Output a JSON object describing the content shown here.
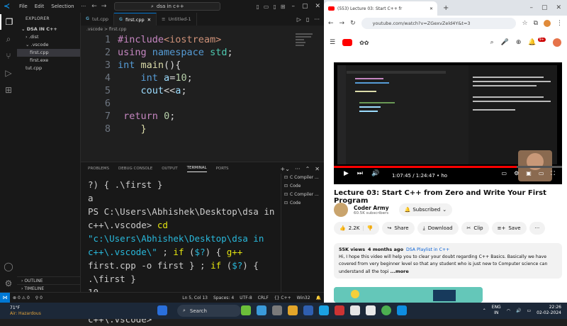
{
  "vscode": {
    "menus": [
      "File",
      "Edit",
      "Selection"
    ],
    "search": "dsa in c++",
    "explorer_header": "EXPLORER",
    "folder": "DSA IN C++",
    "tree": [
      {
        "label": ".dist",
        "indent": 2,
        "selected": false,
        "chevron": "›"
      },
      {
        "label": ".vscode",
        "indent": 2,
        "selected": false,
        "chevron": "⌄"
      },
      {
        "label": "first.cpp",
        "indent": 3,
        "selected": true,
        "chevron": ""
      },
      {
        "label": "first.exe",
        "indent": 3,
        "selected": false,
        "chevron": ""
      },
      {
        "label": "tut.cpp",
        "indent": 2,
        "selected": false,
        "chevron": ""
      }
    ],
    "outline": "OUTLINE",
    "timeline": "TIMELINE",
    "tabs": [
      {
        "label": "tut.cpp",
        "active": false
      },
      {
        "label": "first.cpp",
        "active": true
      },
      {
        "label": "Untitled-1",
        "active": false
      }
    ],
    "breadcrumb": ".vscode  >  first.cpp",
    "code_lines": [
      {
        "n": "1",
        "html": "<span class='k-pre'>#include</span><span class='k-str'>&lt;iostream&gt;</span>"
      },
      {
        "n": "2",
        "html": "<span class='k-pre'>using</span> <span class='k-type'>namespace</span> <span class='k-ns'>std</span>;"
      },
      {
        "n": "3",
        "html": "<span class='k-type'>int</span> <span class='k-fn'>main</span>(){"
      },
      {
        "n": "4",
        "html": "    <span class='k-type'>int</span> <span class='k-var'>a</span>=<span class='k-num'>10</span>;"
      },
      {
        "n": "5",
        "html": "    <span class='k-var'>cout</span>&lt;&lt;<span class='k-var'>a</span>;"
      },
      {
        "n": "6",
        "html": ""
      },
      {
        "n": "7",
        "html": " <span class='k-ret'>return</span> <span class='k-num'>0</span>;"
      },
      {
        "n": "8",
        "html": "    <span class='k-fn'>}</span>"
      }
    ],
    "panel_tabs": [
      "PROBLEMS",
      "DEBUG CONSOLE",
      "OUTPUT",
      "TERMINAL",
      "PORTS"
    ],
    "panel_active": "TERMINAL",
    "terminal_lines": [
      "?) { .\\first }",
      "a",
      "PS C:\\Users\\Abhishek\\Desktop\\dsa in c++\\.vscode> cd \"c:\\Users\\Abhishek\\Desktop\\dsa in c++\\.vscode\\\" ; if ($?) { g++ first.cpp -o first } ; if ($?) { .\\first }",
      "10",
      "PS C:\\Users\\Abhishek\\Desktop\\dsa in c++\\.vscode>"
    ],
    "terminal_list": [
      "C Compiler ...",
      "Code",
      "C Compiler ...",
      "Code"
    ],
    "status": {
      "errors": "0",
      "warnings": "0",
      "ports": "0",
      "position": "Ln 5, Col 13",
      "spaces": "Spaces: 4",
      "encoding": "UTF-8",
      "eol": "CRLF",
      "language": "{} C++",
      "platform": "Win32"
    }
  },
  "browser": {
    "tab_title": "(553) Lecture 03: Start C++ fr",
    "url": "youtube.com/watch?v=ZGexvZeld4Y&t=3",
    "bell_count": "9+",
    "player_time": "1:07:45 / 1:24:47",
    "player_chapter": "• ho",
    "video_title": "Lecture 03: Start C++ from Zero and Write Your First Program",
    "channel": "Coder Army",
    "subscribers": "60.5K subscribers",
    "subscribed_label": "Subscribed",
    "likes": "2.2K",
    "share": "Share",
    "download": "Download",
    "clip": "Clip",
    "save": "Save",
    "views": "55K views",
    "age": "4 months ago",
    "playlist": "DSA Playlist in C++",
    "description": "Hi, I hope this video will help you to clear your doubt regarding C++ Basics. Basically we have covered from very beginner level so that any student who is just new to Computer science can understand all the topi",
    "more": "...more",
    "accent": "#ff0000"
  },
  "taskbar": {
    "weather_temp": "71°F",
    "weather_text": "Air: Hazardous",
    "search": "Search",
    "lang": "ENG",
    "region": "IN",
    "time": "22:26",
    "date": "02-02-2024"
  }
}
